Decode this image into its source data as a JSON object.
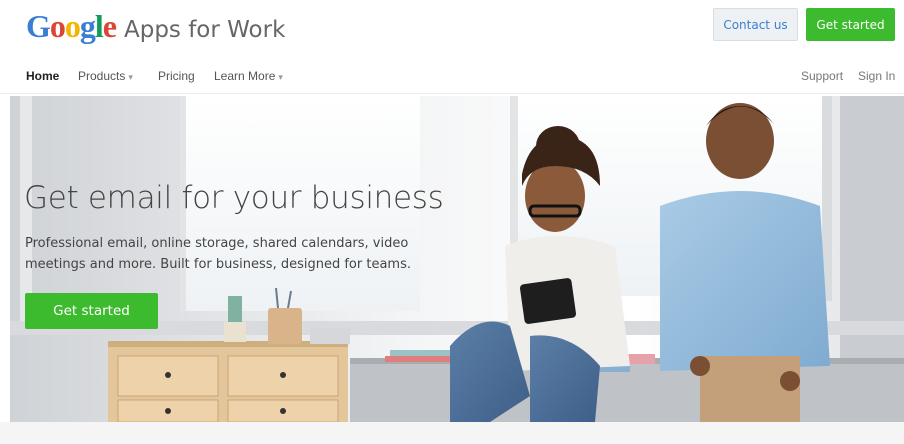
{
  "header": {
    "logo_letters": [
      {
        "char": "G",
        "color": "#3b7ed1"
      },
      {
        "char": "o",
        "color": "#db4437"
      },
      {
        "char": "o",
        "color": "#f4b400"
      },
      {
        "char": "g",
        "color": "#3b7ed1"
      },
      {
        "char": "l",
        "color": "#0f9d58"
      },
      {
        "char": "e",
        "color": "#db4437"
      }
    ],
    "logo_suffix": "Apps for Work",
    "contact_label": "Contact us",
    "get_started_label": "Get started"
  },
  "nav": {
    "home": "Home",
    "products": "Products",
    "pricing": "Pricing",
    "learn_more": "Learn More",
    "support": "Support",
    "sign_in": "Sign In",
    "caret": "▾"
  },
  "hero": {
    "title": "Get email for your business",
    "subtitle": "Professional email, online storage, shared calendars, video meetings and more. Built for business, designed for teams.",
    "cta_label": "Get started"
  },
  "colors": {
    "accent_green": "#3dbb2e",
    "link_blue": "#3b7ed1"
  }
}
